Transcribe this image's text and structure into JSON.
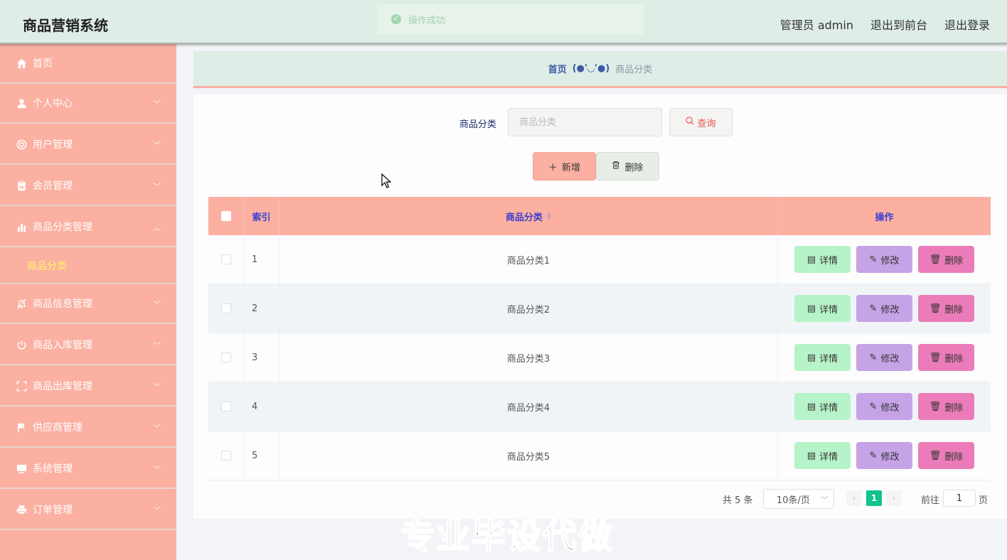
{
  "header": {
    "title": "商品营销系统",
    "admin": "管理员 admin",
    "front": "退出到前台",
    "logout": "退出登录"
  },
  "toast": {
    "message": "操作成功"
  },
  "sidebar": {
    "items": [
      {
        "label": "首页",
        "icon": "home-icon"
      },
      {
        "label": "个人中心",
        "icon": "user-icon"
      },
      {
        "label": "用户管理",
        "icon": "lifebuoy-icon"
      },
      {
        "label": "会员管理",
        "icon": "clipboard-icon"
      },
      {
        "label": "商品分类管理",
        "icon": "bar-chart-icon"
      },
      {
        "label": "商品信息管理",
        "icon": "bell-off-icon"
      },
      {
        "label": "商品入库管理",
        "icon": "power-icon"
      },
      {
        "label": "商品出库管理",
        "icon": "fullscreen-icon"
      },
      {
        "label": "供应商管理",
        "icon": "flag-icon"
      },
      {
        "label": "系统管理",
        "icon": "monitor-icon"
      },
      {
        "label": "订单管理",
        "icon": "printer-icon"
      }
    ],
    "sub_item": "商品分类"
  },
  "breadcrumb": {
    "home": "首页",
    "separator": "(●'◡'●)",
    "current": "商品分类"
  },
  "search": {
    "label": "商品分类",
    "placeholder": "商品分类",
    "button": "查询"
  },
  "toolbar": {
    "add": "新增",
    "delete": "删除"
  },
  "table": {
    "headers": {
      "index": "索引",
      "category": "商品分类",
      "actions": "操作"
    },
    "rows": [
      {
        "index": "1",
        "category": "商品分类1"
      },
      {
        "index": "2",
        "category": "商品分类2"
      },
      {
        "index": "3",
        "category": "商品分类3"
      },
      {
        "index": "4",
        "category": "商品分类4"
      },
      {
        "index": "5",
        "category": "商品分类5"
      }
    ],
    "actions": {
      "detail": "详情",
      "edit": "修改",
      "remove": "删除"
    }
  },
  "pagination": {
    "total": "共 5 条",
    "page_size": "10条/页",
    "current": "1",
    "goto_prefix": "前往",
    "goto_value": "1",
    "goto_suffix": "页"
  },
  "watermark": "专业毕设代做",
  "colors": {
    "header_bg": "#deede6",
    "sidebar_bg": "#fbb0a2",
    "accent_green": "#13c28c",
    "detail_btn": "#b7f3c9",
    "edit_btn": "#c6a2e6",
    "remove_btn": "#ec7cb9"
  }
}
